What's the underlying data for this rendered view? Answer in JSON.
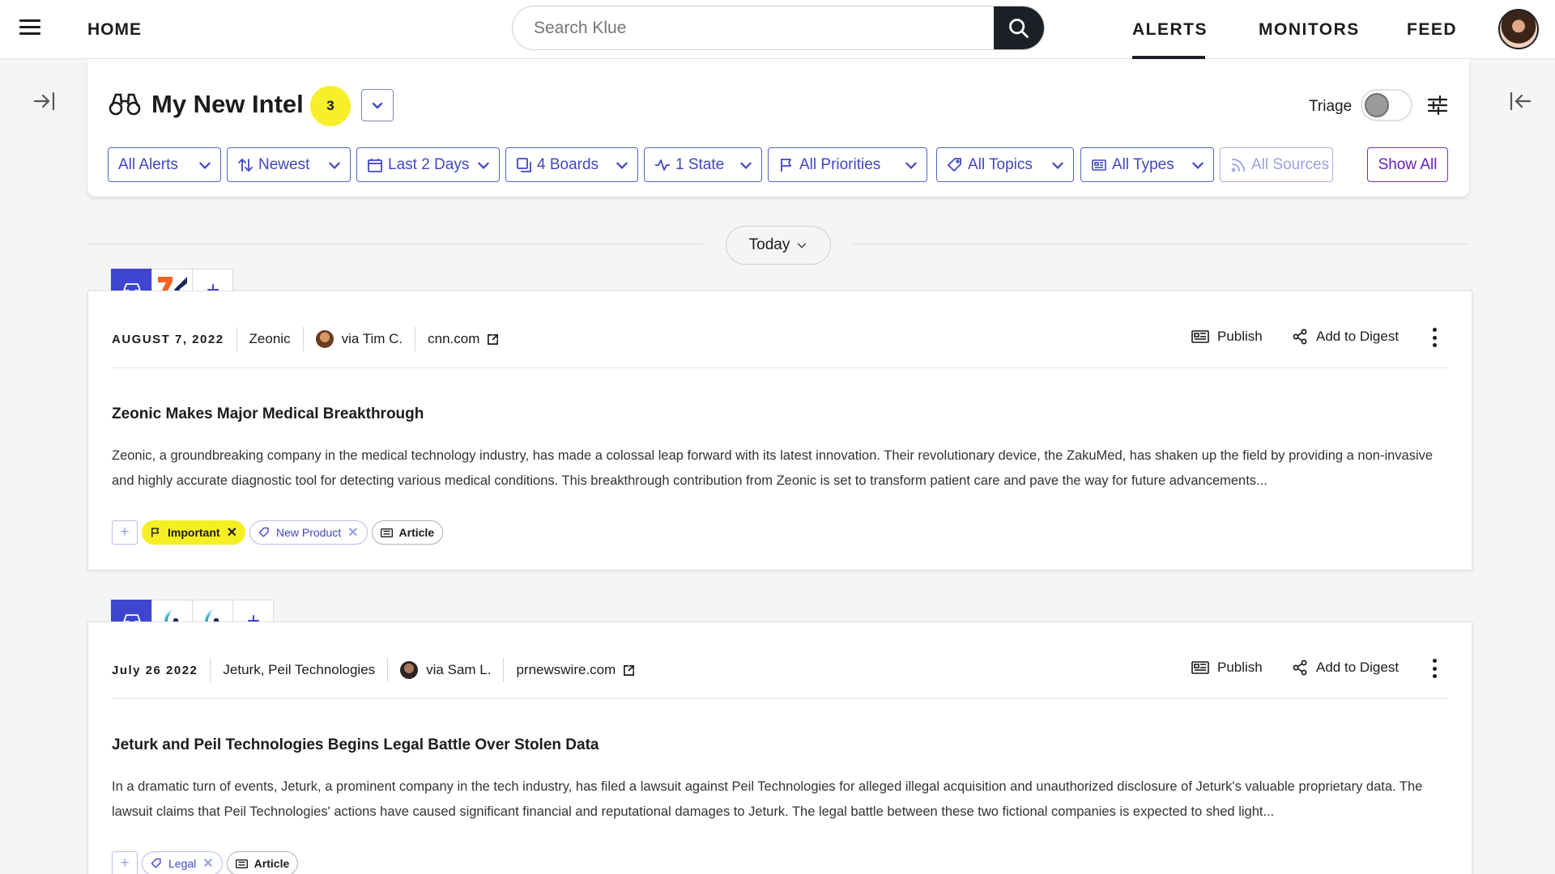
{
  "nav": {
    "home": "HOME",
    "search_placeholder": "Search Klue",
    "alerts": "ALERTS",
    "monitors": "MONITORS",
    "feed": "FEED"
  },
  "header": {
    "title": "My New Intel",
    "count": "3",
    "triage_label": "Triage",
    "triage_on": false,
    "filters": [
      {
        "label": "All Alerts",
        "icon": "none"
      },
      {
        "label": "Newest",
        "icon": "sort-icon"
      },
      {
        "label": "Last 2 Days",
        "icon": "calendar-icon"
      },
      {
        "label": "4 Boards",
        "icon": "boards-icon"
      },
      {
        "label": "1 State",
        "icon": "activity-icon"
      },
      {
        "label": "All Priorities",
        "icon": "flag-icon"
      },
      {
        "label": "All Topics",
        "icon": "tag-icon"
      },
      {
        "label": "All Types",
        "icon": "newspaper-icon"
      },
      {
        "label": "All Sources",
        "icon": "rss-icon"
      }
    ],
    "show_all": "Show All"
  },
  "divider": {
    "label": "Today"
  },
  "cards": [
    {
      "date": "AUGUST 7, 2022",
      "company": "Zeonic",
      "via": "via Tim C.",
      "source": "cnn.com",
      "publish": "Publish",
      "add_to_digest": "Add to Digest",
      "headline": "Zeonic Makes Major Medical Breakthrough",
      "body": "Zeonic, a groundbreaking company in the medical technology industry, has made a colossal leap forward with its latest innovation. Their revolutionary device, the ZakuMed, has shaken up the field by providing a non-invasive and highly accurate diagnostic tool for detecting various medical conditions. This breakthrough contribution from Zeonic is set to transform patient care and pave the way for future advancements...",
      "tags": {
        "priority": "Important",
        "topic": "New Product",
        "type": "Article"
      }
    },
    {
      "date": "July 26 2022",
      "company": "Jeturk, Peil Technologies",
      "via": "via Sam L.",
      "source": "prnewswire.com",
      "publish": "Publish",
      "add_to_digest": "Add to Digest",
      "headline": "Jeturk and Peil Technologies Begins Legal Battle Over Stolen Data",
      "body": "In a dramatic turn of events, Jeturk, a prominent company in the tech industry, has filed a lawsuit against Peil Technologies for alleged illegal acquisition and unauthorized disclosure of Jeturk's valuable proprietary data. The lawsuit claims that Peil Technologies' actions have caused significant financial and reputational damages to Jeturk. The legal battle between these two fictional companies is expected to shed light...",
      "tags": {
        "topic": "Legal",
        "type": "Article"
      }
    }
  ],
  "colors": {
    "brand_blue": "#3e46d0",
    "filter_blue": "#3f47c4",
    "badge_yellow": "#f7ef2a",
    "show_all_purple": "#6b1fb8",
    "nav_dark": "#1c2027"
  }
}
